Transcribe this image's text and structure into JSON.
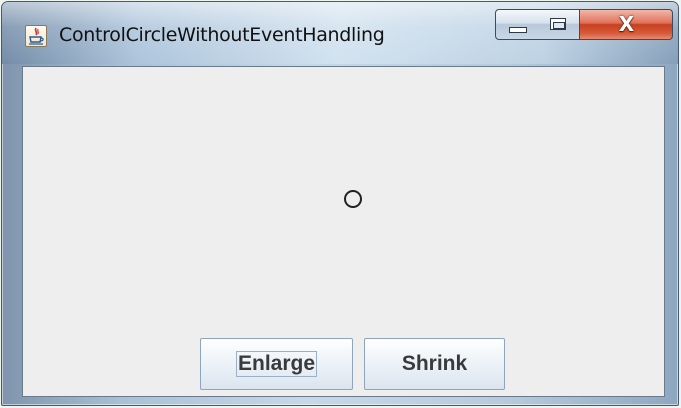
{
  "window": {
    "title": "ControlCircleWithoutEventHandling",
    "app_icon": "java-icon",
    "caption_buttons": {
      "minimize_icon": "minimize-icon",
      "maximize_icon": "maximize-icon",
      "close_glyph": "X"
    }
  },
  "panel": {
    "background": "#eeeeee",
    "shape": "circle-icon"
  },
  "buttons": {
    "enlarge_label": "Enlarge",
    "shrink_label": "Shrink"
  },
  "colors": {
    "close_button": "#c7401f",
    "title_text": "#111111"
  }
}
